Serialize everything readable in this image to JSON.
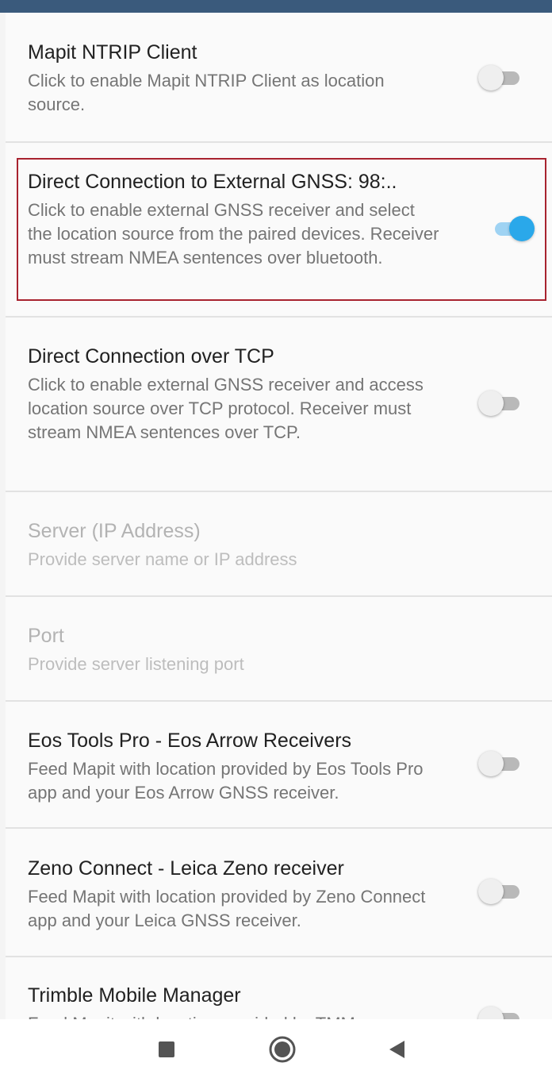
{
  "colors": {
    "accent": "#2aa8ea",
    "highlight_border": "#a8232f",
    "header": "#3a5a7c"
  },
  "preferences": [
    {
      "title": "Mapit NTRIP Client",
      "summary": "Click to enable Mapit NTRIP Client as location source.",
      "enabled": false
    },
    {
      "title": "Direct Connection to External GNSS: 98:..",
      "summary": "Click to enable external GNSS receiver and select the location source from the paired devices. Receiver must stream NMEA sentences over bluetooth.",
      "enabled": true
    },
    {
      "title": "Direct Connection over TCP",
      "summary": "Click to enable external GNSS receiver and access location source over TCP protocol. Receiver must stream NMEA sentences over TCP.",
      "enabled": false
    },
    {
      "title": "Server (IP Address)",
      "summary": "Provide server name or IP address"
    },
    {
      "title": "Port",
      "summary": "Provide server listening port"
    },
    {
      "title": "Eos Tools Pro - Eos Arrow Receivers",
      "summary": "Feed Mapit with location provided by Eos Tools Pro app and your Eos Arrow GNSS receiver.",
      "enabled": false
    },
    {
      "title": "Zeno Connect - Leica Zeno receiver",
      "summary": "Feed Mapit with location provided by Zeno Connect app and your Leica GNSS receiver.",
      "enabled": false
    },
    {
      "title": "Trimble Mobile Manager",
      "summary": "Feed Mapit with location provided by TMM",
      "enabled": false
    }
  ],
  "navbar": {
    "icons": [
      "recents-icon",
      "home-icon",
      "back-icon"
    ]
  }
}
